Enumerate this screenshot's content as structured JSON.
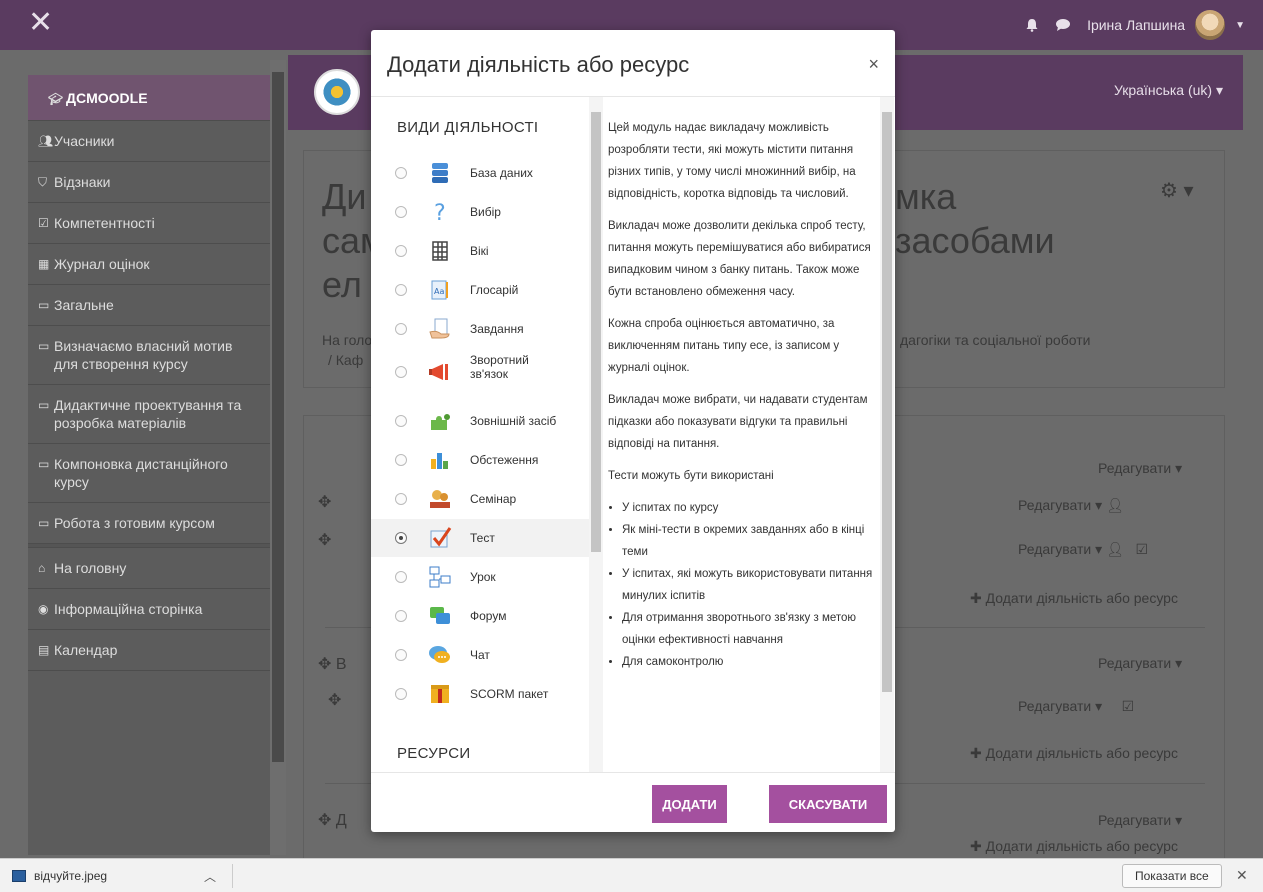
{
  "navbar": {
    "close_glyph": "✕",
    "user_name": "Ірина Лапшина"
  },
  "sidebar": {
    "home_section": "ДСMOODLE",
    "items": [
      {
        "label": "Учасники",
        "icon": "users-icon"
      },
      {
        "label": "Відзнаки",
        "icon": "shield-icon"
      },
      {
        "label": "Компетентності",
        "icon": "checkbox-icon"
      },
      {
        "label": "Журнал оцінок",
        "icon": "table-icon"
      },
      {
        "label": "Загальне",
        "icon": "folder-icon"
      },
      {
        "label": "Визначаємо власний мотив для створення курсу",
        "icon": "folder-icon"
      },
      {
        "label": "Дидактичне проектування та розробка матеріалів",
        "icon": "folder-icon"
      },
      {
        "label": "Компоновка дистанційного курсу",
        "icon": "folder-icon"
      },
      {
        "label": "Робота з готовим курсом",
        "icon": "folder-icon"
      }
    ],
    "bottom_items": [
      {
        "label": "На головну",
        "icon": "home-icon"
      },
      {
        "label": "Інформаційна сторінка",
        "icon": "dashboard-icon"
      },
      {
        "label": "Календар",
        "icon": "calendar-icon"
      }
    ]
  },
  "page": {
    "language": "Українська (uk) ▾",
    "title_line1": "Ди",
    "title_line1_right": "мка",
    "title_line2": "сам",
    "title_line2_right": "засобами",
    "title_line3": "ел",
    "breadcrumb_left": "На голо",
    "breadcrumb_left2": "/ Каф",
    "breadcrumb_right": "дагогіки та соціальної роботи",
    "edit_label": "Редагувати",
    "add_resource_label": "Додати діяльність або ресурс",
    "section_letter_1": "В",
    "section_letter_2": "Д"
  },
  "modal": {
    "title": "Додати діяльність або ресурс",
    "close": "×",
    "activities_heading": "ВИДИ ДІЯЛЬНОСТІ",
    "resources_heading": "РЕСУРСИ",
    "options": [
      {
        "label": "База даних",
        "icon": "database-icon",
        "selected": false
      },
      {
        "label": "Вибір",
        "icon": "question-icon",
        "selected": false
      },
      {
        "label": "Вікі",
        "icon": "wiki-icon",
        "selected": false
      },
      {
        "label": "Глосарій",
        "icon": "glossary-icon",
        "selected": false
      },
      {
        "label": "Завдання",
        "icon": "assignment-icon",
        "selected": false
      },
      {
        "label": "Зворотний зв'язок",
        "icon": "feedback-icon",
        "selected": false
      },
      {
        "label": "Зовнішній засіб",
        "icon": "puzzle-icon",
        "selected": false
      },
      {
        "label": "Обстеження",
        "icon": "survey-icon",
        "selected": false
      },
      {
        "label": "Семінар",
        "icon": "workshop-icon",
        "selected": false
      },
      {
        "label": "Тест",
        "icon": "quiz-icon",
        "selected": true
      },
      {
        "label": "Урок",
        "icon": "lesson-icon",
        "selected": false
      },
      {
        "label": "Форум",
        "icon": "forum-icon",
        "selected": false
      },
      {
        "label": "Чат",
        "icon": "chat-icon",
        "selected": false
      },
      {
        "label": "SCORM пакет",
        "icon": "scorm-icon",
        "selected": false
      }
    ],
    "description": {
      "p1": "Цей модуль надає викладачу можливість розробляти тести, які можуть містити питання різних типів, у тому числі множинний вибір, на відповідність, коротка відповідь та числовий.",
      "p2": "Викладач може дозволити декілька спроб тесту, питання можуть перемішуватися або вибиратися випадковим чином з банку питань. Також може бути встановлено обмеження часу.",
      "p3": "Кожна спроба оцінюється автоматично, за виключенням питань типу есе, із записом у журналі оцінок.",
      "p4": "Викладач може вибрати, чи надавати студентам підказки або показувати відгуки та правильні відповіді на питання.",
      "p5": "Тести можуть бути використані",
      "bullets": [
        "У іспитах по курсу",
        "Як міні-тести в окремих завданнях або в кінці теми",
        "У іспитах, які можуть використовувати питання минулих іспитів",
        "Для отримання зворотнього зв'язку з метою оцінки ефективності навчання",
        "Для самоконтролю"
      ]
    },
    "add_button": "ДОДАТИ",
    "cancel_button": "СКАСУВАТИ"
  },
  "downloads": {
    "file_name": "відчуйте.jpeg",
    "show_all": "Показати все",
    "close": "✕"
  },
  "colors": {
    "brand_purple": "#5a3b60",
    "button_purple": "#a4509f"
  }
}
